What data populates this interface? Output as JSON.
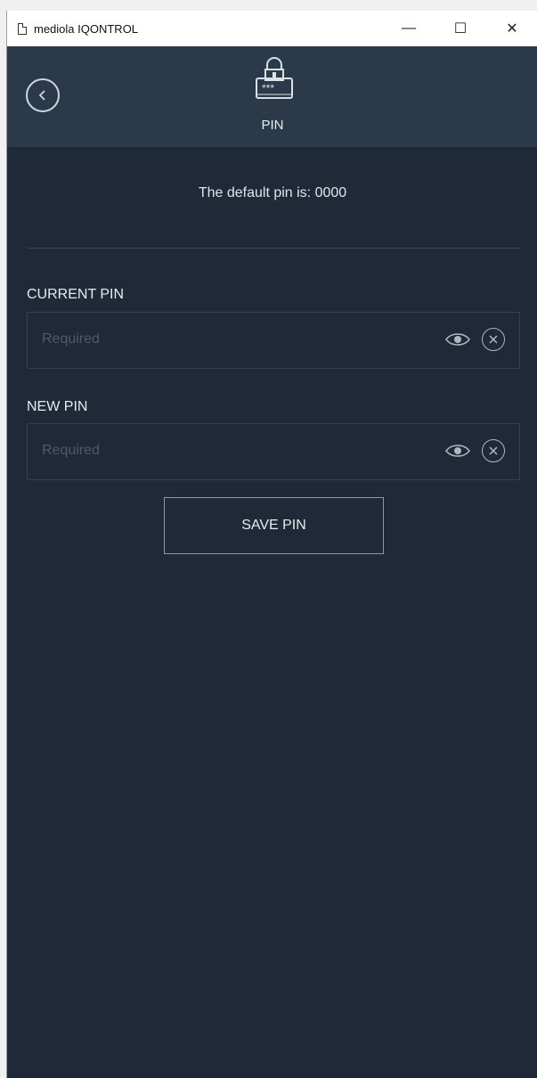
{
  "window": {
    "title": "mediola IQONTROL",
    "controls": {
      "minimize": "—",
      "maximize": "☐",
      "close": "✕"
    }
  },
  "header": {
    "title": "PIN",
    "icon": "lock-keypad-icon",
    "back_icon": "chevron-left-circle-icon"
  },
  "main": {
    "hint": "The default pin is: 0000",
    "current_pin": {
      "label": "CURRENT PIN",
      "placeholder": "Required"
    },
    "new_pin": {
      "label": "NEW PIN",
      "placeholder": "Required"
    },
    "save_button": "SAVE PIN"
  },
  "colors": {
    "background": "#1f2937",
    "header": "#2b3a4b",
    "text": "#e6ebef"
  }
}
